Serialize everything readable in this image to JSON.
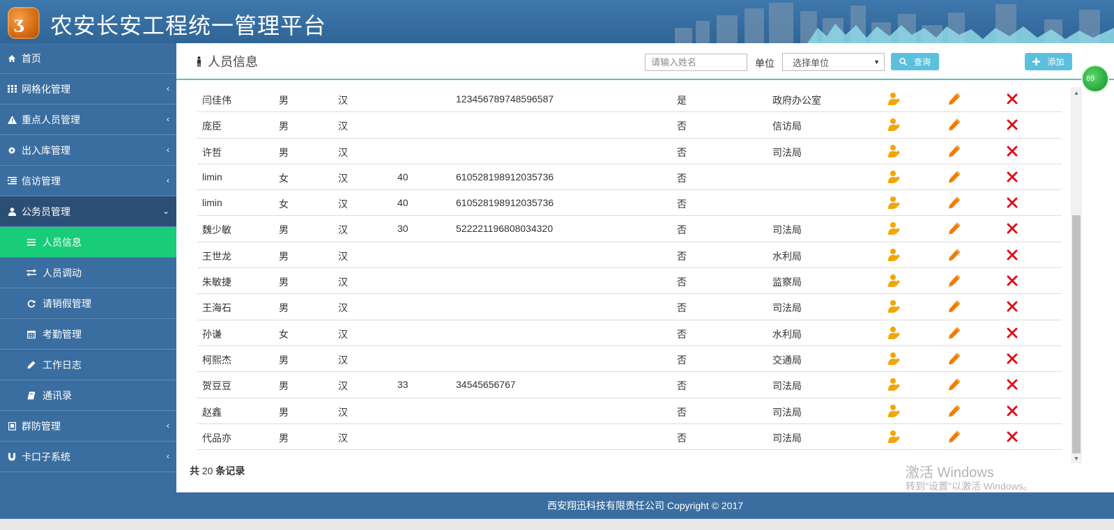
{
  "header": {
    "title": "农安长安工程统一管理平台"
  },
  "sidebar": {
    "items": [
      {
        "label": "首页",
        "icon": "home-icon"
      },
      {
        "label": "网格化管理",
        "icon": "grid-icon"
      },
      {
        "label": "重点人员管理",
        "icon": "warning-icon"
      },
      {
        "label": "出入库管理",
        "icon": "gear-icon"
      },
      {
        "label": "信访管理",
        "icon": "list-icon"
      },
      {
        "label": "公务员管理",
        "icon": "user-icon"
      }
    ],
    "subitems": [
      {
        "label": "人员信息",
        "icon": "menu-icon"
      },
      {
        "label": "人员调动",
        "icon": "exchange-icon"
      },
      {
        "label": "请销假管理",
        "icon": "refresh-icon"
      },
      {
        "label": "考勤管理",
        "icon": "calendar-icon"
      },
      {
        "label": "工作日志",
        "icon": "pencil-icon"
      },
      {
        "label": "通讯录",
        "icon": "book-icon"
      }
    ],
    "after": [
      {
        "label": "群防管理",
        "icon": "shield-icon"
      },
      {
        "label": "卡口子系统",
        "icon": "magnet-icon"
      }
    ]
  },
  "main": {
    "title": "人员信息",
    "search_placeholder": "请输入姓名",
    "unit_label": "单位",
    "unit_select_value": "选择单位",
    "query_label": "查询",
    "add_label": "添加",
    "rows": [
      {
        "name": "闫佳伟",
        "sex": "男",
        "nation": "汉",
        "age": "",
        "id": "123456789748596587",
        "flag": "是",
        "unit": "政府办公室"
      },
      {
        "name": "庞臣",
        "sex": "男",
        "nation": "汉",
        "age": "",
        "id": "",
        "flag": "否",
        "unit": "信访局"
      },
      {
        "name": "许哲",
        "sex": "男",
        "nation": "汉",
        "age": "",
        "id": "",
        "flag": "否",
        "unit": "司法局"
      },
      {
        "name": "limin",
        "sex": "女",
        "nation": "汉",
        "age": "40",
        "id": "610528198912035736",
        "flag": "否",
        "unit": ""
      },
      {
        "name": "limin",
        "sex": "女",
        "nation": "汉",
        "age": "40",
        "id": "610528198912035736",
        "flag": "否",
        "unit": ""
      },
      {
        "name": "魏少敏",
        "sex": "男",
        "nation": "汉",
        "age": "30",
        "id": "522221196808034320",
        "flag": "否",
        "unit": "司法局"
      },
      {
        "name": "王世龙",
        "sex": "男",
        "nation": "汉",
        "age": "",
        "id": "",
        "flag": "否",
        "unit": "水利局"
      },
      {
        "name": "朱敏捷",
        "sex": "男",
        "nation": "汉",
        "age": "",
        "id": "",
        "flag": "否",
        "unit": "监察局"
      },
      {
        "name": "王海石",
        "sex": "男",
        "nation": "汉",
        "age": "",
        "id": "",
        "flag": "否",
        "unit": "司法局"
      },
      {
        "name": "孙谦",
        "sex": "女",
        "nation": "汉",
        "age": "",
        "id": "",
        "flag": "否",
        "unit": "水利局"
      },
      {
        "name": "柯熙杰",
        "sex": "男",
        "nation": "汉",
        "age": "",
        "id": "",
        "flag": "否",
        "unit": "交通局"
      },
      {
        "name": "贺豆豆",
        "sex": "男",
        "nation": "汉",
        "age": "33",
        "id": "34545656767",
        "flag": "否",
        "unit": "司法局"
      },
      {
        "name": "赵鑫",
        "sex": "男",
        "nation": "汉",
        "age": "",
        "id": "",
        "flag": "否",
        "unit": "司法局"
      },
      {
        "name": "代品亦",
        "sex": "男",
        "nation": "汉",
        "age": "",
        "id": "",
        "flag": "否",
        "unit": "司法局"
      }
    ],
    "record_prefix": "共",
    "record_count": "20",
    "record_suffix": "条记录"
  },
  "watermark": {
    "line1": "激活 Windows",
    "line2": "转到\"设置\"以激活 Windows。"
  },
  "footer": {
    "text": "西安翔迅科技有限责任公司 Copyright © 2017"
  },
  "badge": {
    "text": "69"
  },
  "colors": {
    "header": "#3f78ac",
    "sidebar": "#3b6ea0",
    "active": "#18cc78",
    "button": "#5bc0de",
    "delete": "#e60012",
    "edit": "#f07d00",
    "person": "#f5a400"
  }
}
